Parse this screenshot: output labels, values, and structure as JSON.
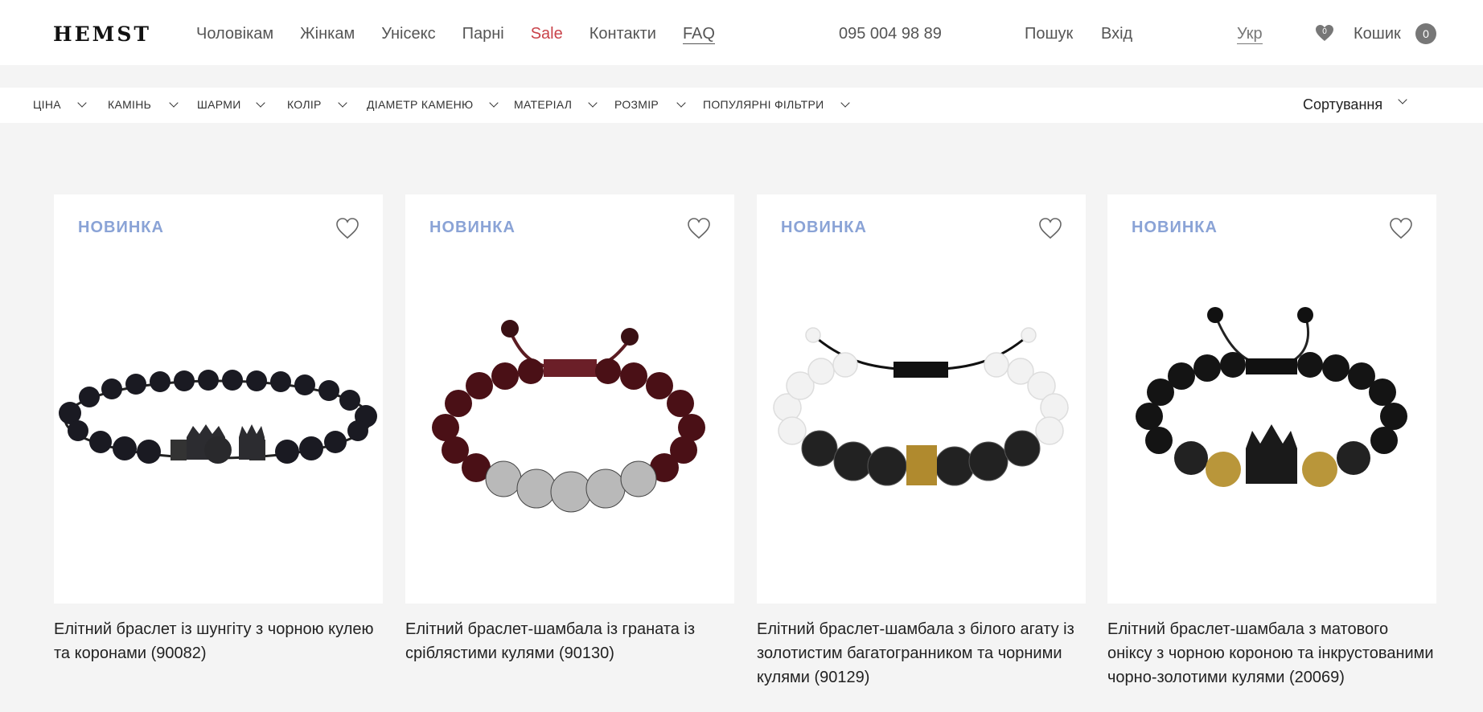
{
  "header": {
    "logo": "HEMST",
    "nav": [
      "Чоловікам",
      "Жінкам",
      "Унісекс",
      "Парні",
      "Sale",
      "Контакти",
      "FAQ"
    ],
    "phone": "095 004 98 89",
    "search": "Пошук",
    "login": "Вхід",
    "lang": "Укр",
    "wishlist_count": "0",
    "cart_label": "Кошик",
    "cart_count": "0",
    "icons": {
      "wishlist": "heart-icon"
    },
    "colors": {
      "sale": "#c9434a"
    }
  },
  "filters": {
    "items": [
      "ЦІНА",
      "КАМІНЬ",
      "ШАРМИ",
      "КОЛІР",
      "ДІАМЕТР КАМЕНЮ",
      "МАТЕРІАЛ",
      "РОЗМІР",
      "ПОПУЛЯРНІ ФІЛЬТРИ"
    ],
    "sort_label": "Сортування"
  },
  "products": [
    {
      "badge": "НОВИНКА",
      "title": "Елітний браслет із шунгіту з чорною кулею та коронами (90082)",
      "image": "bracelet-black-crowns"
    },
    {
      "badge": "НОВИНКА",
      "title": "Елітний браслет-шамбала із граната із сріблястими кулями (90130)",
      "image": "bracelet-garnet-silver"
    },
    {
      "badge": "НОВИНКА",
      "title": "Елітний браслет-шамбала з білого агату із золотистим багатогранником та чорними кулями (90129)",
      "image": "bracelet-white-agate"
    },
    {
      "badge": "НОВИНКА",
      "title": "Елітний браслет-шамбала з матового оніксу з чорною короною та інкрустованими чорно-золотими кулями (20069)",
      "image": "bracelet-onyx-crown"
    }
  ],
  "colors": {
    "badge": "#8aa3d6",
    "background": "#f4f4f4"
  }
}
